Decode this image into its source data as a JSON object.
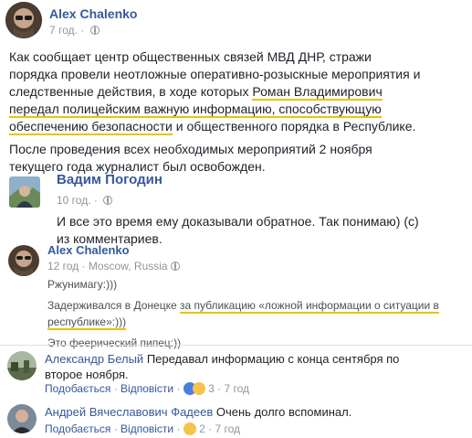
{
  "post": {
    "author": "Alex Chalenko",
    "time": "7 год.",
    "text_a": "Как сообщает центр общественных связей МВД ДНР, стражи порядка провели неотложные оперативно-розыскные мероприятия и следственные действия, в ходе которых ",
    "text_hl1": "Роман Владимирович передал полицейским важную информацию, способствующую обеспечению безопасности",
    "text_b": " и общественного порядка в Республике.",
    "text_2": "После проведения всех необходимых мероприятий 2 ноября текущего года журналист был освобожден."
  },
  "reply1": {
    "author": "Вадим Погодин",
    "time": "10 год.",
    "text": "И все это время ему доказывали обратное. Так понимаю) (с) из комментариев."
  },
  "reply2": {
    "author": "Alex Chalenko",
    "time": "12 год",
    "location": "Moscow, Russia",
    "line1": "Ржунимагу:)))",
    "line2_a": "Задерживался в Донецке ",
    "line2_hl": "за публикацию «ложной информации о ситуации в республике»:)))",
    "line3": "Это феерический пипец:))"
  },
  "comments": [
    {
      "author": "Александр Белый",
      "text": "Передавал информацию с конца сентября по второе ноября.",
      "like": "Подобається",
      "reply": "Відповісти",
      "count": "3",
      "time": "7 год"
    },
    {
      "author": "Андрей Вячеславович Фадеев",
      "text": "Очень долго вспоминал.",
      "like": "Подобається",
      "reply": "Відповісти",
      "count": "2",
      "time": "7 год"
    }
  ]
}
